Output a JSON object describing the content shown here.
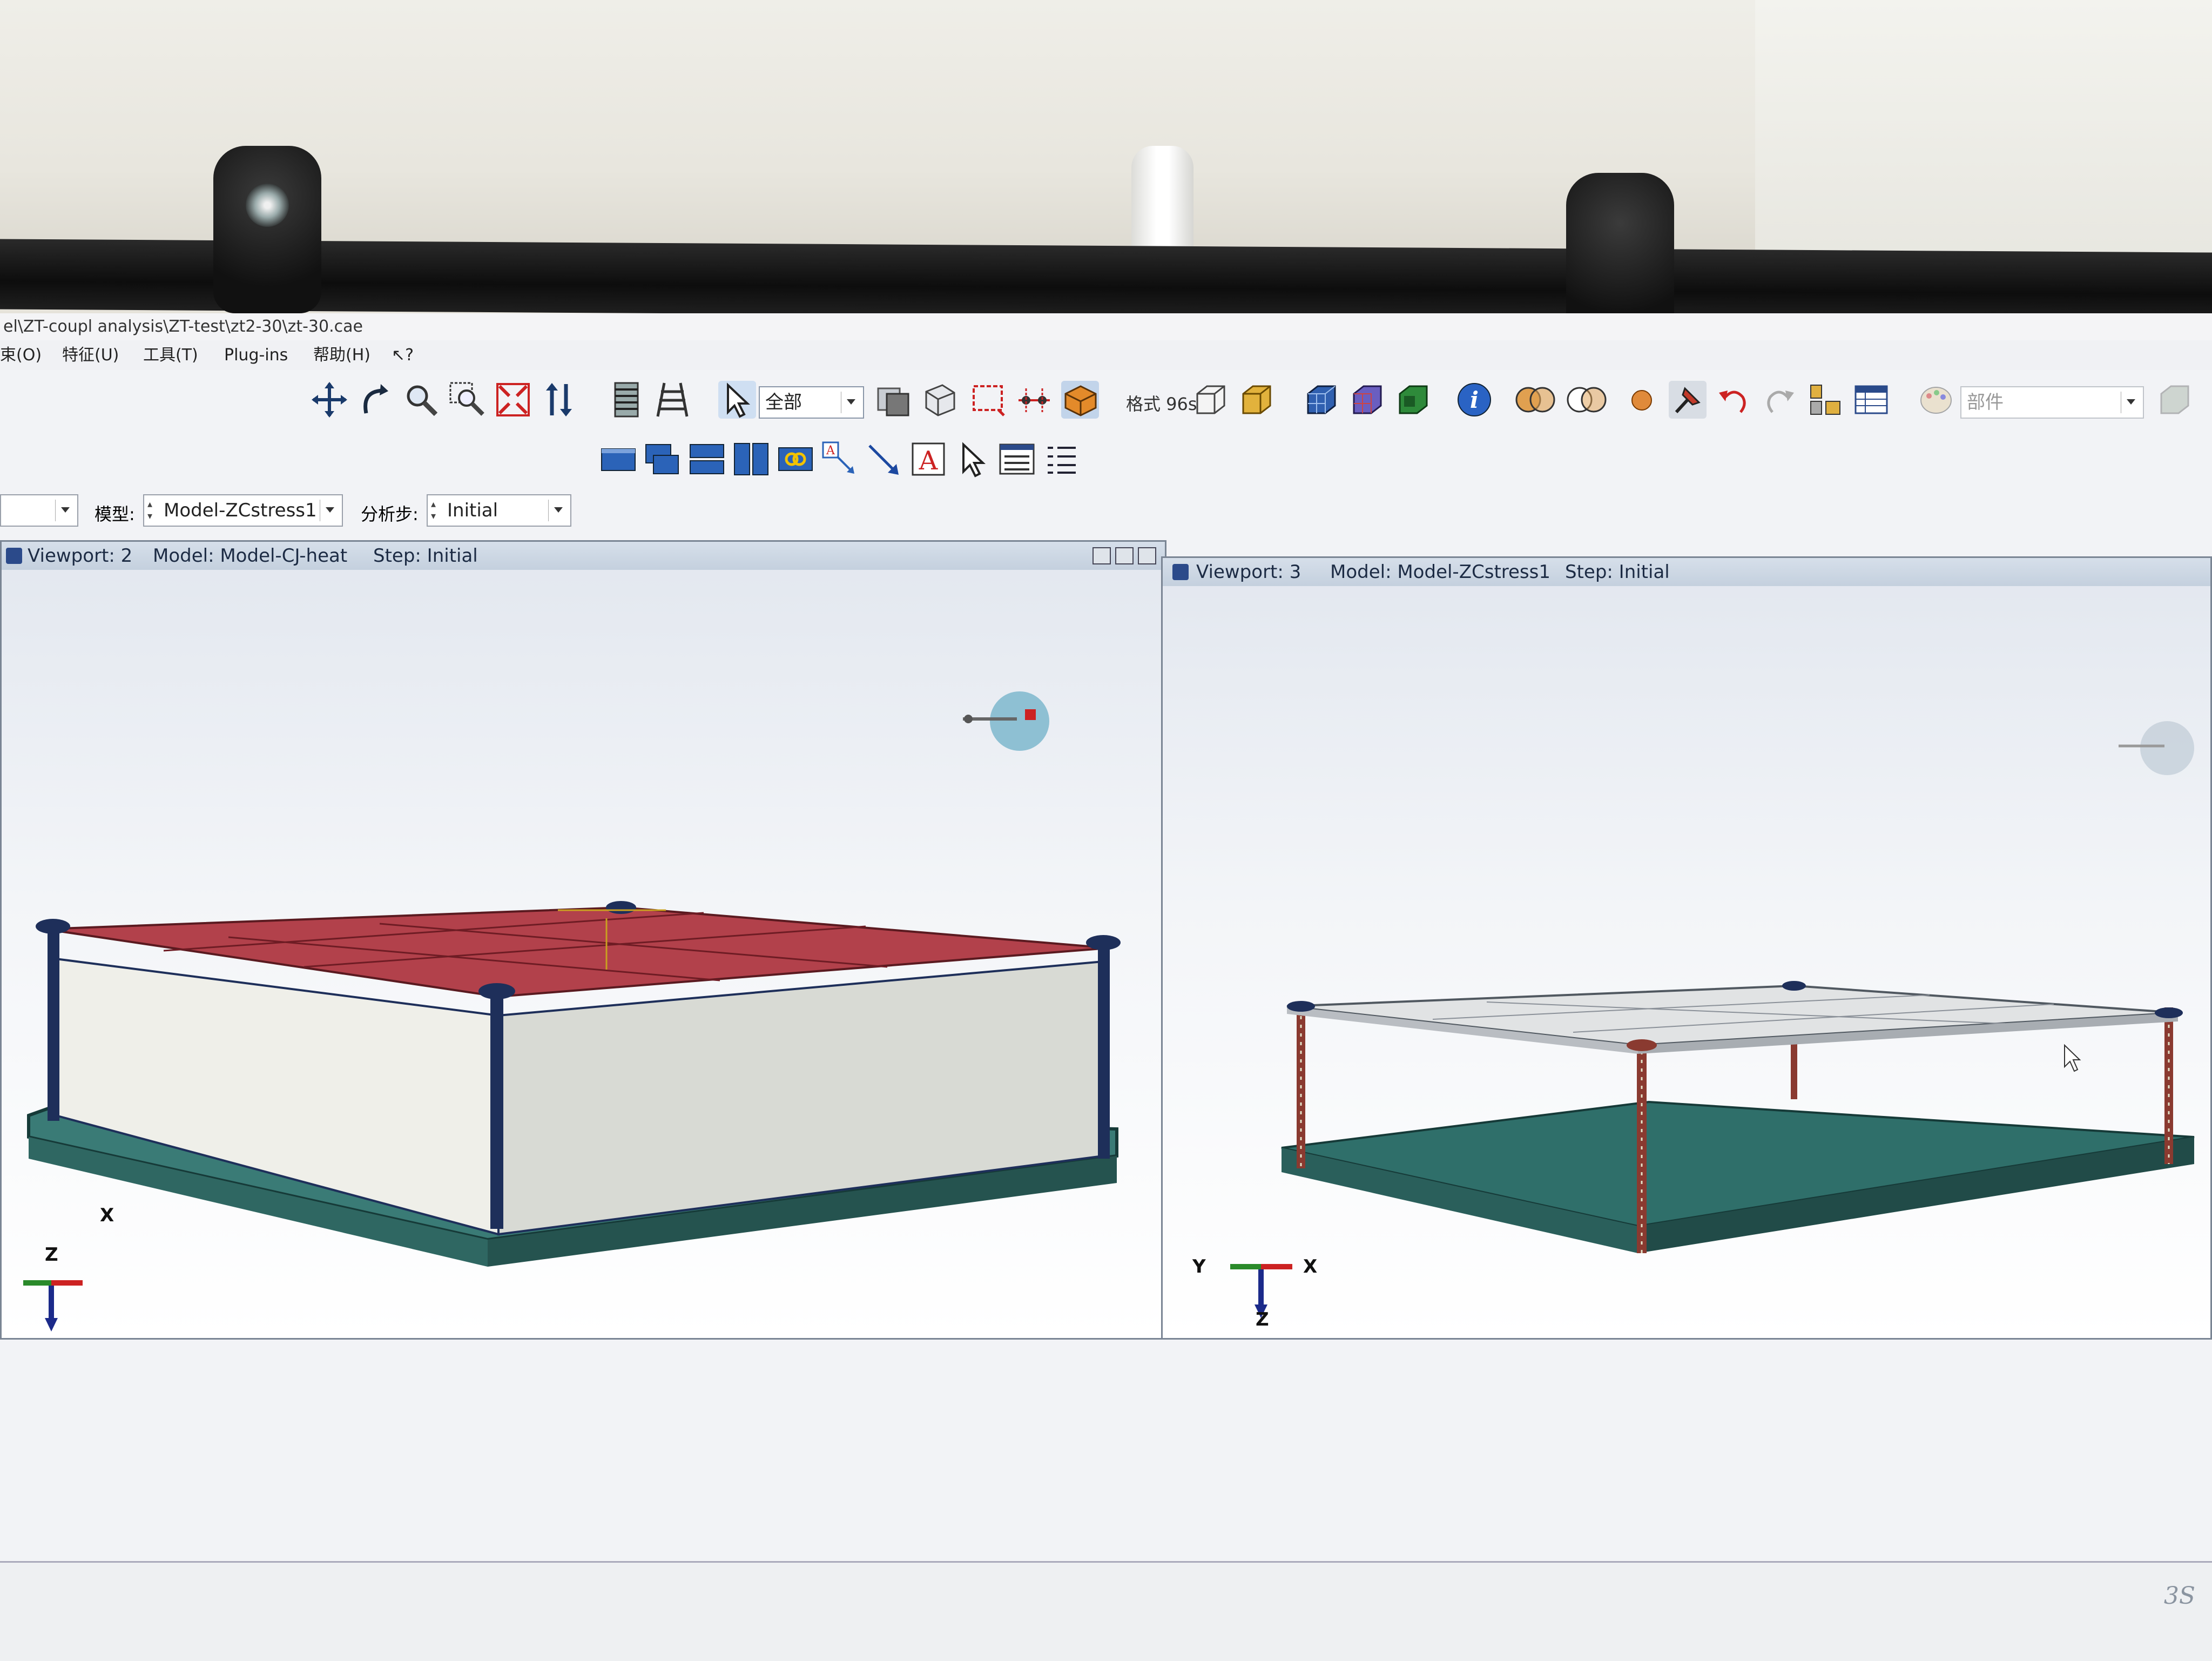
{
  "window": {
    "title": "el\\ZT-coupl analysis\\ZT-test\\zt2-30\\zt-30.cae"
  },
  "menubar": {
    "items": [
      {
        "label": "束(O)"
      },
      {
        "label": "特征(U)"
      },
      {
        "label": "工具(T)"
      },
      {
        "label": "Plug-ins"
      },
      {
        "label": "帮助(H)"
      },
      {
        "label": "↖?"
      }
    ]
  },
  "toolbar": {
    "selection_filter": "全部",
    "render_style_label": "格式 96s",
    "part_selector": "部件",
    "icons": [
      "pan-icon",
      "rotate-icon",
      "zoom-icon",
      "box-zoom-icon",
      "fit-view-icon",
      "cycle-views-icon",
      "ruler-icon",
      "layers-icon",
      "select-arrow-icon",
      "wireframe-icon",
      "hidden-line-icon",
      "shaded-icon",
      "cube-front-icon",
      "cube-iso-icon",
      "mesh-cube-icon",
      "query-info-icon",
      "boolean-icon",
      "sphere-icon",
      "pin-icon",
      "undo-icon",
      "redo-icon",
      "partition-icon",
      "table-icon",
      "palette-icon"
    ]
  },
  "context": {
    "model_label": "模型:",
    "model_value": "Model-ZCstress1",
    "step_label": "分析步:",
    "step_value": "Initial"
  },
  "viewports": [
    {
      "name": "Viewport: 2",
      "model": "Model: Model-CJ-heat",
      "step": "Step: Initial"
    },
    {
      "name": "Viewport: 3",
      "model": "Model: Model-ZCstress1",
      "step": "Step: Initial"
    }
  ],
  "triad": {
    "x": "X",
    "y": "Y",
    "z": "Z"
  },
  "colors": {
    "top_slab": "#b2414b",
    "walls": "#efefe9",
    "base": "#3a7b76",
    "columns": "#1e2f5a",
    "viewport_header": "#c8d3e0"
  }
}
